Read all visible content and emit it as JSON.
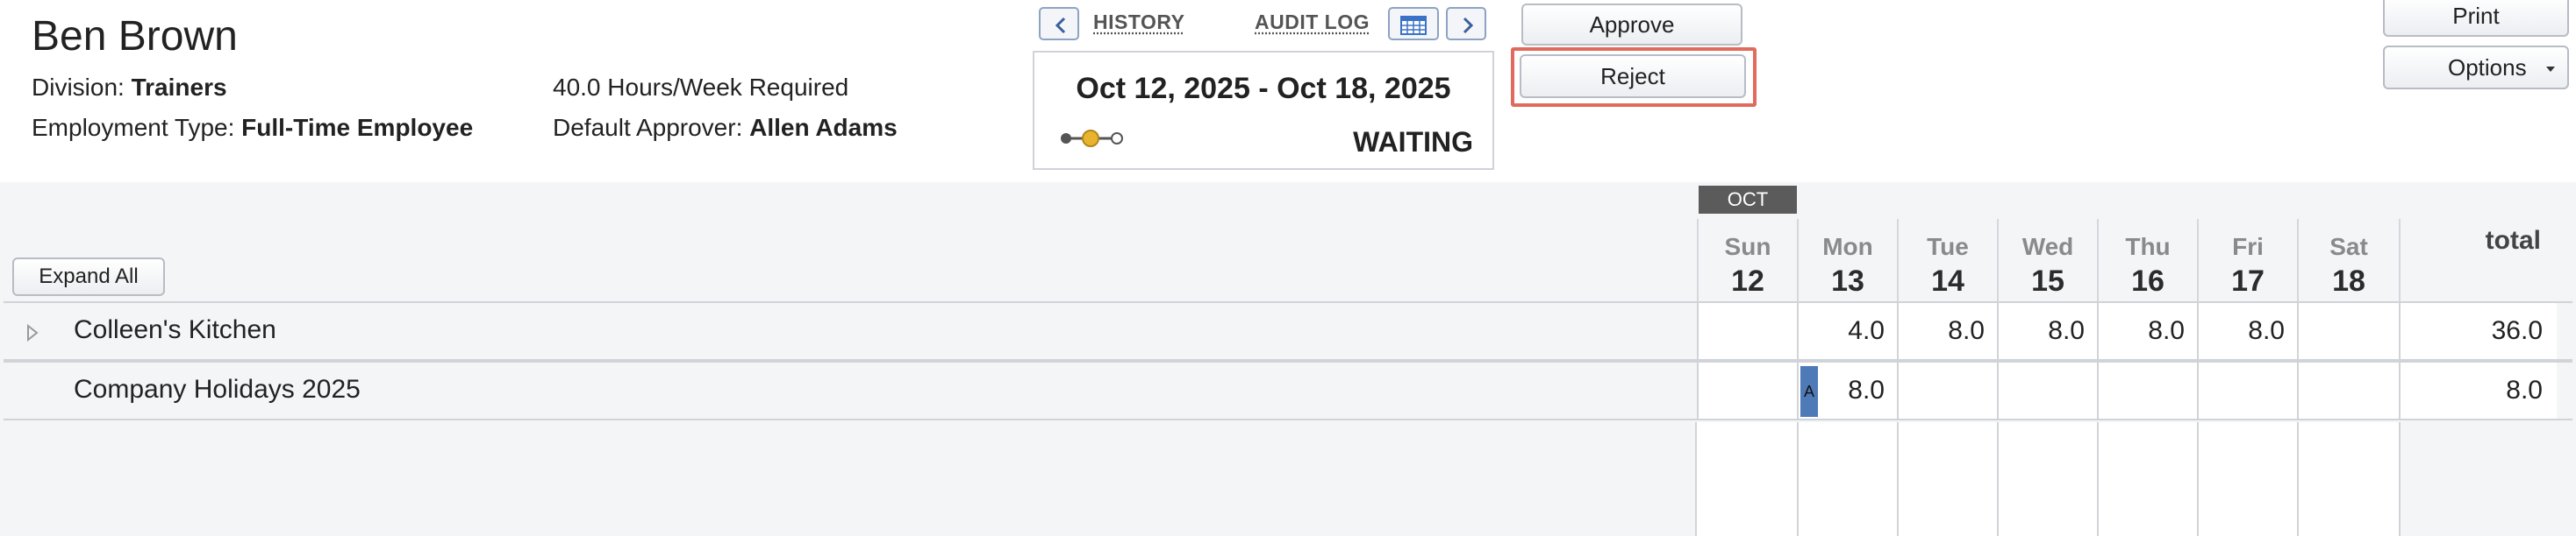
{
  "employee": {
    "name": "Ben Brown",
    "division_label": "Division: ",
    "division": "Trainers",
    "employment_type_label": "Employment Type: ",
    "employment_type": "Full-Time Employee",
    "hours_required": "40.0 Hours/Week Required",
    "approver_label": "Default Approver: ",
    "approver": "Allen Adams"
  },
  "nav": {
    "history": "HISTORY",
    "audit_log": "AUDIT LOG"
  },
  "period": {
    "range": "Oct 12, 2025 - Oct 18, 2025",
    "status": "WAITING",
    "progress_step": 2,
    "progress_steps": 3
  },
  "actions": {
    "approve": "Approve",
    "reject": "Reject",
    "print": "Print",
    "options": "Options"
  },
  "grid": {
    "month": "OCT",
    "expand_all": "Expand All",
    "total_label": "total",
    "days": [
      {
        "name": "Sun",
        "num": "12"
      },
      {
        "name": "Mon",
        "num": "13"
      },
      {
        "name": "Tue",
        "num": "14"
      },
      {
        "name": "Wed",
        "num": "15"
      },
      {
        "name": "Thu",
        "num": "16"
      },
      {
        "name": "Fri",
        "num": "17"
      },
      {
        "name": "Sat",
        "num": "18"
      }
    ],
    "rows": [
      {
        "label": "Colleen's Kitchen",
        "cells": [
          "",
          "4.0",
          "8.0",
          "8.0",
          "8.0",
          "8.0",
          ""
        ],
        "total": "36.0"
      },
      {
        "label": "Company Holidays 2025",
        "cells": [
          "",
          "8.0",
          "",
          "",
          "",
          "",
          ""
        ],
        "total": "8.0",
        "marker": "A"
      }
    ]
  },
  "colors": {
    "accent": "#4f7ab8",
    "highlight": "#e06a5c",
    "progress_active": "#e8b430"
  }
}
